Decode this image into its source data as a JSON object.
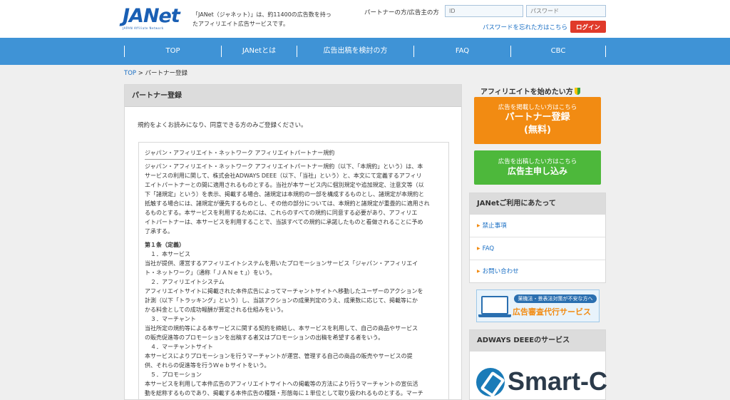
{
  "header": {
    "logo_text": "JANet",
    "logo_sub": "JAPAN Affiliate Network",
    "tagline": "「JANet（ジャネット）」は、約11400の広告数を持ったアフィリエイト広告サービスです。",
    "login_label": "パートナーの方/広告主の方",
    "id_placeholder": "ID",
    "password_placeholder": "パスワード",
    "forgot_link": "パスワードを忘れた方はこちら",
    "login_button": "ログイン"
  },
  "nav": {
    "items": [
      {
        "label": "TOP"
      },
      {
        "label": "JANetとは"
      },
      {
        "label": "広告出稿を検討の方"
      },
      {
        "label": "FAQ"
      },
      {
        "label": "CBC"
      }
    ]
  },
  "breadcrumb": {
    "home": "TOP",
    "separator": ">",
    "current": "パートナー登録"
  },
  "main": {
    "title": "パートナー登録",
    "intro": "規約をよくお読みになり、同意できる方のみご登録ください。",
    "terms": {
      "title": "ジャパン・アフィリエイト・ネットワーク アフィリエイトパートナー規約",
      "lines": [
        "ジャパン・アフィリエイト・ネットワーク アフィリエイトパートナー規約（以下、「本規約」という）は、本",
        "サービスの利用に関して、株式会社ADWAYS DEEE（以下、「当社」という）と、本文にて定義するアフィリ",
        "エイトパートナーとの間に適用されるものとする。当社が本サービス内に個別規定や追加規定、注意文等（以",
        "下「諸規定」という）を表示、掲載する場合、諸規定は本規約の一部を構成するものとし、諸規定が本規約と",
        "抵触する場合には、諸規定が優先するものとし、その他の部分については、本規約と諸規定が重畳的に適用され",
        "るものとする。本サービスを利用するためには、これらのすべての規約に同意する必要があり、アフィリエ",
        "イトパートナーは、本サービスを利用することで、当該すべての規約に承諾したものと看做されることに予め",
        "了承する。"
      ],
      "article_title": "第１条（定義）",
      "items": [
        {
          "heading": "１．本サービス",
          "text": [
            "当社が提供、運営するアフィリエイトシステムを用いたプロモーションサービス「ジャパン・アフィリエイ",
            "ト・ネットワーク」（通称「ＪＡＮｅｔ」）をいう。"
          ]
        },
        {
          "heading": "２．アフィリエイトシステム",
          "text": [
            "アフィリエイトサイトに掲載された本件広告によってマーチャントサイトへ移動したユーザーのアクションを",
            "計測（以下「トラッキング」という）し、当該アクションの成果判定のうえ、成果数に応じて、掲載等にか",
            "かる料金としての成功報酬が算定される仕組みをいう。"
          ]
        },
        {
          "heading": "３．マーチャント",
          "text": [
            "当社所定の規約等による本サービスに関する契約を締結し、本サービスを利用して、自己の商品やサービス",
            "の販売促進等のプロモーションを出稿する者又はプロモーションの出稿を希望する者をいう。"
          ]
        },
        {
          "heading": "４．マーチャントサイト",
          "text": [
            "本サービスによりプロモーションを行うマーチャントが運営、管理する自己の商品の販売やサービスの提",
            "供、それらの促進等を行うＷｅｂサイトをいう。"
          ]
        },
        {
          "heading": "５．プロモーション",
          "text": [
            "本サービスを利用して本件広告のアフィリエイトサイトへの掲載等の方法により行うマーチャントの宣伝活",
            "動を総称するものであり、掲載する本件広告の種類・形態毎に１単位として取り扱われるものとする。マーチ"
          ]
        }
      ]
    }
  },
  "sidebar": {
    "start_heading": "アフィリエイトを始めたい方",
    "partner_cta": {
      "small": "広告を掲載したい方はこちら",
      "big_line1": "パートナー登録",
      "big_line2": "(無料)"
    },
    "advertiser_cta": {
      "small": "広告を出稿したい方はこちら",
      "big": "広告主申し込み"
    },
    "usage_box": {
      "title": "JANetご利用にあたって",
      "links": [
        {
          "label": "禁止事項"
        },
        {
          "label": "FAQ"
        },
        {
          "label": "お問い合わせ"
        }
      ]
    },
    "banner": {
      "small": "薬機法・景表法対策が不安な方へ",
      "big": "広告審査代行サービス"
    },
    "adways_box": {
      "title": "ADWAYS DEEEのサービス",
      "logo_text": "Smart-C"
    }
  },
  "colors": {
    "nav_bg": "#3f93d6",
    "login_btn": "#e03a2a",
    "partner_cta": "#f28b12",
    "advertiser_cta": "#4db83b",
    "link": "#1a6fc4"
  }
}
